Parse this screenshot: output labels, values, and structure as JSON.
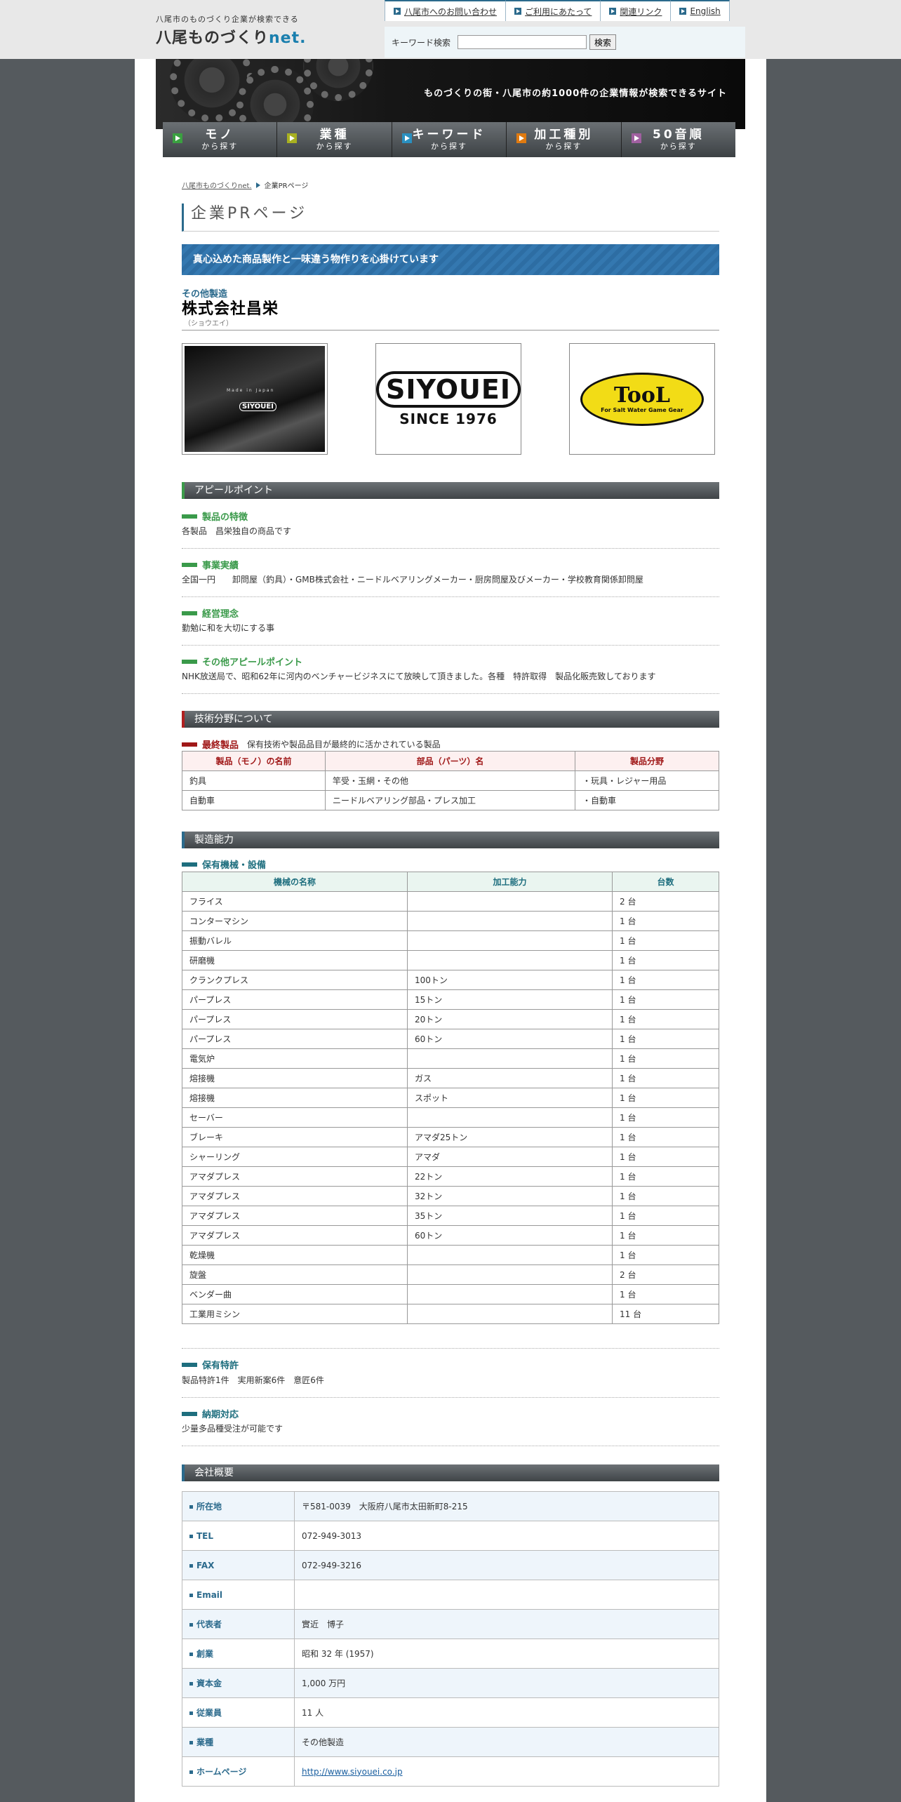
{
  "header": {
    "logo_sub": "八尾市のものづくり企業が検索できる",
    "logo_main": "八尾ものづくり",
    "logo_net": "net.",
    "links": [
      "八尾市へのお問い合わせ",
      "ご利用にあたって",
      "関連リンク",
      "English"
    ],
    "search_label": "キーワード検索",
    "search_value": "",
    "search_button": "検索"
  },
  "banner": {
    "text": "ものづくりの街・八尾市の約1000件の企業情報が検索できるサイト"
  },
  "nav": [
    {
      "title": "モノ",
      "sub": "から探す",
      "color": "#3aa040"
    },
    {
      "title": "業種",
      "sub": "から探す",
      "color": "#a8b020"
    },
    {
      "title": "キーワード",
      "sub": "から探す",
      "color": "#2a90c0"
    },
    {
      "title": "加工種別",
      "sub": "から探す",
      "color": "#e07a10"
    },
    {
      "title": "50音順",
      "sub": "から探す",
      "color": "#a060a0"
    }
  ],
  "breadcrumb": {
    "home": "八尾市ものづくりnet.",
    "current": "企業PRページ"
  },
  "page_title": "企業PRページ",
  "catchcopy": "真心込めた商品製作と一味違う物作りを心掛けています",
  "company": {
    "category": "その他製造",
    "name": "株式会社昌栄",
    "kana": "（ショウエイ）"
  },
  "photos": {
    "p1_text": "Made in Japan",
    "p2_line1": "SIYOUEI",
    "p2_line2": "SINCE 1976",
    "p3_main": "TooL",
    "p3_sub": "For Salt Water Game Gear"
  },
  "appeal": {
    "heading": "アピールポイント",
    "items": [
      {
        "title": "製品の特徴",
        "text": "各製品　昌栄独自の商品です"
      },
      {
        "title": "事業実績",
        "text": "全国一円　　卸問屋（釣具）・GMB株式会社・ニードルベアリングメーカー・厨房問屋及びメーカー・学校教育関係卸問屋"
      },
      {
        "title": "経営理念",
        "text": "勤勉に和を大切にする事"
      },
      {
        "title": "その他アピールポイント",
        "text": "NHK放送局で、昭和62年に河内のベンチャービジネスにて放映して頂きました。各種　特許取得　製品化販売致しております"
      }
    ]
  },
  "tech": {
    "heading": "技術分野について",
    "sub": "最終製品",
    "sub_note": "保有技術や製品品目が最終的に活かされている製品",
    "headers": [
      "製品（モノ）の名前",
      "部品（パーツ）名",
      "製品分野"
    ],
    "rows": [
      [
        "釣具",
        "竿受・玉網・その他",
        "・玩具・レジャー用品"
      ],
      [
        "自動車",
        "ニードルベアリング部品・プレス加工",
        "・自動車"
      ]
    ]
  },
  "mfg": {
    "heading": "製造能力",
    "sub": "保有機械・設備",
    "headers": [
      "機械の名称",
      "加工能力",
      "台数"
    ],
    "rows": [
      [
        "フライス",
        "",
        "2 台"
      ],
      [
        "コンターマシン",
        "",
        "1 台"
      ],
      [
        "振動バレル",
        "",
        "1 台"
      ],
      [
        "研磨機",
        "",
        "1 台"
      ],
      [
        "クランクプレス",
        "100トン",
        "1 台"
      ],
      [
        "パープレス",
        "15トン",
        "1 台"
      ],
      [
        "パープレス",
        "20トン",
        "1 台"
      ],
      [
        "パープレス",
        "60トン",
        "1 台"
      ],
      [
        "電気炉",
        "",
        "1 台"
      ],
      [
        "熔接機",
        "ガス",
        "1 台"
      ],
      [
        "熔接機",
        "スポット",
        "1 台"
      ],
      [
        "セーバー",
        "",
        "1 台"
      ],
      [
        "ブレーキ",
        "アマダ25トン",
        "1 台"
      ],
      [
        "シャーリング",
        "アマダ",
        "1 台"
      ],
      [
        "アマダプレス",
        "22トン",
        "1 台"
      ],
      [
        "アマダプレス",
        "32トン",
        "1 台"
      ],
      [
        "アマダプレス",
        "35トン",
        "1 台"
      ],
      [
        "アマダプレス",
        "60トン",
        "1 台"
      ],
      [
        "乾燥機",
        "",
        "1 台"
      ],
      [
        "旋盤",
        "",
        "2 台"
      ],
      [
        "ベンダー曲",
        "",
        "1 台"
      ],
      [
        "工業用ミシン",
        "",
        "11 台"
      ]
    ],
    "patent_title": "保有特許",
    "patent_text": "製品特許1件　実用新案6件　意匠6件",
    "delivery_title": "納期対応",
    "delivery_text": "少量多品種受注が可能です"
  },
  "overview": {
    "heading": "会社概要",
    "rows": [
      [
        "所在地",
        "〒581-0039　大阪府八尾市太田新町8-215"
      ],
      [
        "TEL",
        "072-949-3013"
      ],
      [
        "FAX",
        "072-949-3216"
      ],
      [
        "Email",
        ""
      ],
      [
        "代表者",
        "實近　博子"
      ],
      [
        "創業",
        "昭和 32 年 (1957)"
      ],
      [
        "資本金",
        "1,000 万円"
      ],
      [
        "従業員",
        "11 人"
      ],
      [
        "業種",
        "その他製造"
      ],
      [
        "ホームページ",
        "http://www.siyouei.co.jp"
      ]
    ]
  },
  "colors": {
    "accent": "#2b6a8c",
    "green": "#3a9a4a",
    "red": "#a01818",
    "teal": "#1e6e7e"
  }
}
